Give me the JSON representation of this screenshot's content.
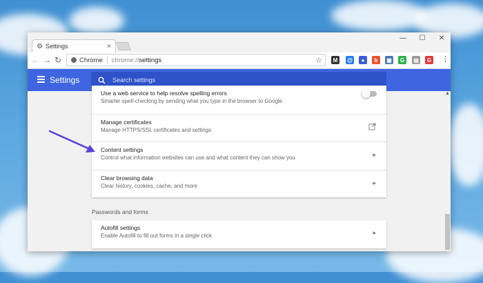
{
  "window": {
    "tab_title": "Settings",
    "tab_close": "×",
    "minimize": "—",
    "maximize": "☐",
    "close": "✕"
  },
  "toolbar": {
    "back": "←",
    "forward": "→",
    "reload": "↻",
    "site_label": "Chrome",
    "url_scheme": "chrome://",
    "url_path": "settings",
    "star": "☆",
    "menu": "⋮",
    "extensions": [
      {
        "name": "m-ext-icon",
        "glyph": "M",
        "color": "#333333"
      },
      {
        "name": "q-ext-icon",
        "glyph": "@",
        "color": "#2b7de9"
      },
      {
        "name": "blue-ext-icon",
        "glyph": "●",
        "color": "#3b5bdb"
      },
      {
        "name": "red-ext-icon",
        "glyph": "b",
        "color": "#e8542f"
      },
      {
        "name": "tab-ext-icon",
        "glyph": "▣",
        "color": "#4a7ab5"
      },
      {
        "name": "green-ext-icon",
        "glyph": "G",
        "color": "#2fb04c"
      },
      {
        "name": "gray-ext-icon",
        "glyph": "▤",
        "color": "#9a9a9a"
      },
      {
        "name": "red-g-ext-icon",
        "glyph": "G",
        "color": "#e03b3b"
      }
    ]
  },
  "header": {
    "title": "Settings",
    "search_placeholder": "Search settings",
    "color": "#3f66e0"
  },
  "privacy_card": {
    "rows": [
      {
        "title": "Use a web service to help resolve spelling errors",
        "subtitle": "Smarter spell-checking by sending what you type in the browser to Google",
        "control": "toggle"
      },
      {
        "title": "Manage certificates",
        "subtitle": "Manage HTTPS/SSL certificates and settings",
        "control": "external-link"
      },
      {
        "title": "Content settings",
        "subtitle": "Control what information websites can use and what content they can show you",
        "control": "chevron"
      },
      {
        "title": "Clear browsing data",
        "subtitle": "Clear history, cookies, cache, and more",
        "control": "chevron"
      }
    ]
  },
  "passwords_section": {
    "title": "Passwords and forms",
    "rows": [
      {
        "title": "Autofill settings",
        "subtitle": "Enable Autofill to fill out forms in a single click",
        "control": "chevron"
      }
    ]
  },
  "glyphs": {
    "chevron": "▸",
    "external": "⧉",
    "search": "🔍",
    "gear": "⚙"
  },
  "annotation_arrow_color": "#5b3fd6"
}
